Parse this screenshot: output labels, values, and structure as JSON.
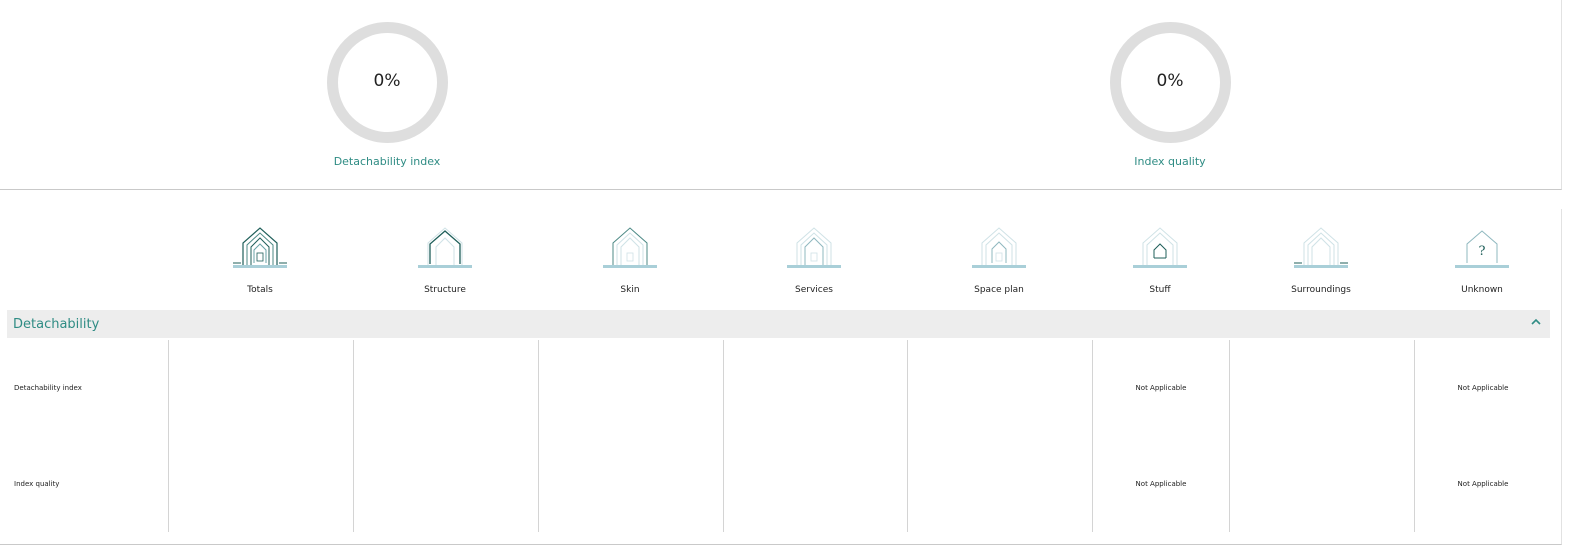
{
  "gauges": [
    {
      "value": "0%",
      "label": "Detachability index",
      "percent": 0
    },
    {
      "value": "0%",
      "label": "Index quality",
      "percent": 0
    }
  ],
  "categories": [
    {
      "label": "Totals",
      "icon": "house-layers-icon"
    },
    {
      "label": "Structure",
      "icon": "house-structure-icon"
    },
    {
      "label": "Skin",
      "icon": "house-skin-icon"
    },
    {
      "label": "Services",
      "icon": "house-services-icon"
    },
    {
      "label": "Space plan",
      "icon": "house-space-plan-icon"
    },
    {
      "label": "Stuff",
      "icon": "house-stuff-icon"
    },
    {
      "label": "Surroundings",
      "icon": "house-surroundings-icon"
    },
    {
      "label": "Unknown",
      "icon": "house-unknown-icon"
    }
  ],
  "section": {
    "title": "Detachability",
    "expanded": true,
    "icon": "chevron-up-icon"
  },
  "rows": [
    {
      "label": "Detachability index",
      "cells": [
        "",
        "",
        "",
        "",
        "",
        "Not Applicable",
        "",
        "Not Applicable"
      ]
    },
    {
      "label": "Index quality",
      "cells": [
        "",
        "",
        "",
        "",
        "",
        "Not Applicable",
        "",
        "Not Applicable"
      ]
    }
  ],
  "colors": {
    "accent": "#2f8c84",
    "ring": "#dedede",
    "icon_dark": "#1f5f5a",
    "icon_light": "#a9cfd8",
    "section_bg": "#ededed"
  }
}
